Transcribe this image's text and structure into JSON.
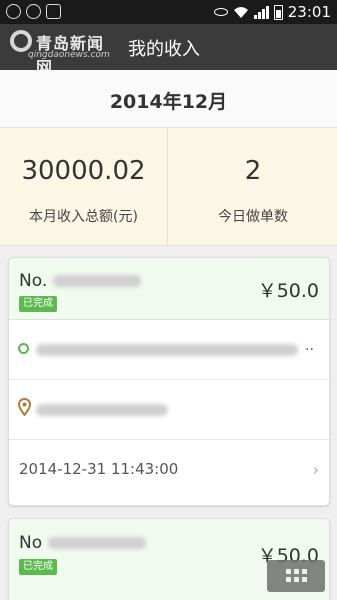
{
  "status_bar": {
    "time": "23:01",
    "left_icons": [
      "wechat-icon",
      "android-icon",
      "image-icon"
    ],
    "right_icons": [
      "eye-icon",
      "wifi-icon",
      "signal-icon",
      "battery-icon"
    ]
  },
  "header": {
    "logo_text": "青岛新闻网",
    "logo_url": "qingdaonews.com",
    "title": "我的收入"
  },
  "month": "2014年12月",
  "stats": {
    "total_income_value": "30000.02",
    "total_income_label": "本月收入总额(元)",
    "orders_today_value": "2",
    "orders_today_label": "今日做单数"
  },
  "orders": [
    {
      "order_no_prefix": "No.",
      "status": "已完成",
      "amount": "￥50.0",
      "ellipsis": "..",
      "time": "2014-12-31 11:43:00"
    },
    {
      "order_no_prefix": "No",
      "status": "已完成",
      "amount": "￥50.0"
    }
  ],
  "colors": {
    "status_bar": "#1a1a1a",
    "title_bar": "#3b3b3b",
    "stats_bg": "#fbf7e6",
    "card_head_bg": "#f1faef",
    "badge_green": "#5bb94e",
    "pin_brown": "#b07a3a"
  }
}
